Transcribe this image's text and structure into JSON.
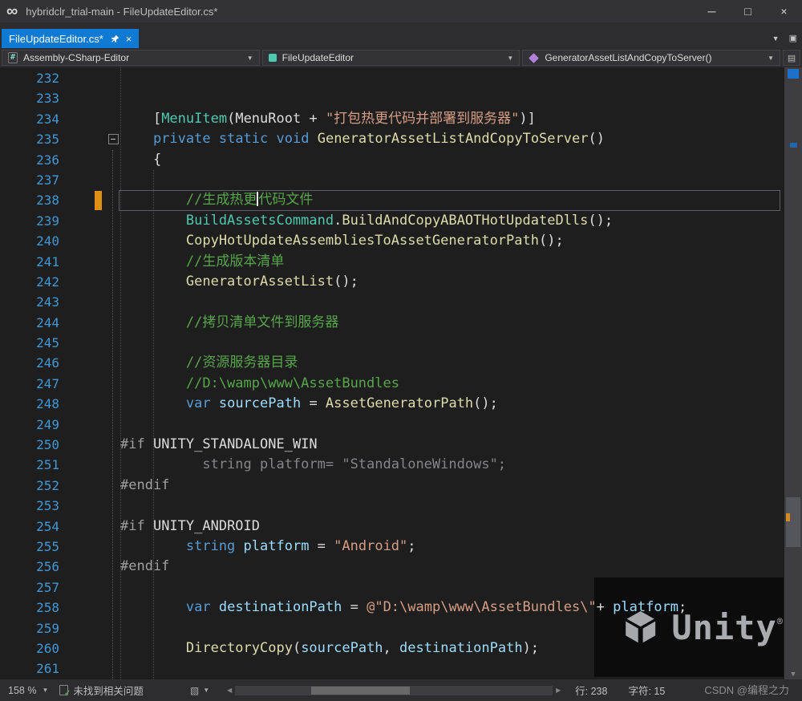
{
  "palette": {
    "plain": "#DCDCDC",
    "keyword": "#569CD6",
    "type": "#4EC9B0",
    "method": "#DCDCAA",
    "string": "#D69D85",
    "comment": "#57A64A",
    "local": "#9CDCFE",
    "preprocessor": "#A0A0A0",
    "inactive": "#85858A",
    "lineNumber": "#4098D4",
    "marker": "#DE9014",
    "currentLineBorder": "#5C5C64",
    "tabActive": "#0E7AD3",
    "editorBg": "#1E1E1E"
  },
  "icons": {
    "vsLogo": "∞",
    "minimize": "─",
    "maximize": "□",
    "close": "×",
    "tabClose": "×",
    "chevronDown": "▼",
    "windows": "▣",
    "navExtra": "▤",
    "cleanup": "▧",
    "scrollDown": "▼",
    "scrollLeft": "◀",
    "scrollRight": "▶",
    "foldCollapse": "−",
    "check": "✓"
  },
  "titlebar": {
    "title": "hybridclr_trial-main - FileUpdateEditor.cs*"
  },
  "tabbar": {
    "activeTab": "FileUpdateEditor.cs*"
  },
  "navbar": {
    "project": "Assembly-CSharp-Editor",
    "type": "FileUpdateEditor",
    "member": "GeneratorAssetListAndCopyToServer()"
  },
  "editor": {
    "lines": [
      {
        "n": 232,
        "ind": 0,
        "tokens": []
      },
      {
        "n": 233,
        "ind": 0,
        "tokens": []
      },
      {
        "n": 234,
        "ind": 4,
        "tokens": [
          {
            "t": "[",
            "c": "pl"
          },
          {
            "t": "MenuItem",
            "c": "ty"
          },
          {
            "t": "(",
            "c": "pl"
          },
          {
            "t": "MenuRoot",
            "c": "pl"
          },
          {
            "t": " + ",
            "c": "pl"
          },
          {
            "t": "\"打包热更代码并部署到服务器\"",
            "c": "st"
          },
          {
            "t": ")]",
            "c": "pl"
          }
        ]
      },
      {
        "n": 235,
        "ind": 4,
        "fold": true,
        "tokens": [
          {
            "t": "private",
            "c": "kw"
          },
          {
            "t": " ",
            "c": "pl"
          },
          {
            "t": "static",
            "c": "kw"
          },
          {
            "t": " ",
            "c": "pl"
          },
          {
            "t": "void",
            "c": "kw"
          },
          {
            "t": " ",
            "c": "pl"
          },
          {
            "t": "GeneratorAssetListAndCopyToServer",
            "c": "me"
          },
          {
            "t": "()",
            "c": "pl"
          }
        ]
      },
      {
        "n": 236,
        "ind": 4,
        "tokens": [
          {
            "t": "{",
            "c": "pl"
          }
        ]
      },
      {
        "n": 237,
        "ind": 0,
        "tokens": []
      },
      {
        "n": 238,
        "ind": 8,
        "cur": true,
        "mark": true,
        "tokens": [
          {
            "t": "//生成热更",
            "c": "co"
          },
          {
            "caret": true
          },
          {
            "t": "代码文件",
            "c": "co"
          }
        ]
      },
      {
        "n": 239,
        "ind": 8,
        "tokens": [
          {
            "t": "BuildAssetsCommand",
            "c": "ty"
          },
          {
            "t": ".",
            "c": "pl"
          },
          {
            "t": "BuildAndCopyABAOTHotUpdateDlls",
            "c": "me"
          },
          {
            "t": "();",
            "c": "pl"
          }
        ]
      },
      {
        "n": 240,
        "ind": 8,
        "tokens": [
          {
            "t": "CopyHotUpdateAssembliesToAssetGeneratorPath",
            "c": "me"
          },
          {
            "t": "();",
            "c": "pl"
          }
        ]
      },
      {
        "n": 241,
        "ind": 8,
        "tokens": [
          {
            "t": "//生成版本清单",
            "c": "co"
          }
        ]
      },
      {
        "n": 242,
        "ind": 8,
        "tokens": [
          {
            "t": "GeneratorAssetList",
            "c": "me"
          },
          {
            "t": "();",
            "c": "pl"
          }
        ]
      },
      {
        "n": 243,
        "ind": 0,
        "tokens": []
      },
      {
        "n": 244,
        "ind": 8,
        "tokens": [
          {
            "t": "//拷贝清单文件到服务器",
            "c": "co"
          }
        ]
      },
      {
        "n": 245,
        "ind": 0,
        "tokens": []
      },
      {
        "n": 246,
        "ind": 8,
        "tokens": [
          {
            "t": "//资源服务器目录",
            "c": "co"
          }
        ]
      },
      {
        "n": 247,
        "ind": 8,
        "tokens": [
          {
            "t": "//D:\\wamp\\www\\AssetBundles",
            "c": "co"
          }
        ]
      },
      {
        "n": 248,
        "ind": 8,
        "tokens": [
          {
            "t": "var",
            "c": "kw"
          },
          {
            "t": " ",
            "c": "pl"
          },
          {
            "t": "sourcePath",
            "c": "lo"
          },
          {
            "t": " = ",
            "c": "pl"
          },
          {
            "t": "AssetGeneratorPath",
            "c": "me"
          },
          {
            "t": "();",
            "c": "pl"
          }
        ]
      },
      {
        "n": 249,
        "ind": 0,
        "tokens": []
      },
      {
        "n": 250,
        "ind": 0,
        "tokens": [
          {
            "t": "#if",
            "c": "pp"
          },
          {
            "t": " UNITY_STANDALONE_WIN",
            "c": "pl"
          }
        ]
      },
      {
        "n": 251,
        "ind": 10,
        "tokens": [
          {
            "t": "string platform= \"StandaloneWindows\";",
            "c": "in"
          }
        ]
      },
      {
        "n": 252,
        "ind": 0,
        "tokens": [
          {
            "t": "#endif",
            "c": "pp"
          }
        ]
      },
      {
        "n": 253,
        "ind": 0,
        "tokens": []
      },
      {
        "n": 254,
        "ind": 0,
        "tokens": [
          {
            "t": "#if",
            "c": "pp"
          },
          {
            "t": " UNITY_ANDROID",
            "c": "pl"
          }
        ]
      },
      {
        "n": 255,
        "ind": 8,
        "tokens": [
          {
            "t": "string",
            "c": "kw"
          },
          {
            "t": " ",
            "c": "pl"
          },
          {
            "t": "platform",
            "c": "lo"
          },
          {
            "t": " = ",
            "c": "pl"
          },
          {
            "t": "\"Android\"",
            "c": "st"
          },
          {
            "t": ";",
            "c": "pl"
          }
        ]
      },
      {
        "n": 256,
        "ind": 0,
        "tokens": [
          {
            "t": "#endif",
            "c": "pp"
          }
        ]
      },
      {
        "n": 257,
        "ind": 0,
        "tokens": []
      },
      {
        "n": 258,
        "ind": 8,
        "tokens": [
          {
            "t": "var",
            "c": "kw"
          },
          {
            "t": " ",
            "c": "pl"
          },
          {
            "t": "destinationPath",
            "c": "lo"
          },
          {
            "t": " = ",
            "c": "pl"
          },
          {
            "t": "@\"D:\\wamp\\www\\AssetBundles\\\"",
            "c": "st"
          },
          {
            "t": "+ ",
            "c": "pl"
          },
          {
            "t": "platform",
            "c": "lo"
          },
          {
            "t": ";",
            "c": "pl"
          }
        ]
      },
      {
        "n": 259,
        "ind": 0,
        "tokens": []
      },
      {
        "n": 260,
        "ind": 8,
        "tokens": [
          {
            "t": "DirectoryCopy",
            "c": "me"
          },
          {
            "t": "(",
            "c": "pl"
          },
          {
            "t": "sourcePath",
            "c": "lo"
          },
          {
            "t": ", ",
            "c": "pl"
          },
          {
            "t": "destinationPath",
            "c": "lo"
          },
          {
            "t": ");",
            "c": "pl"
          }
        ]
      },
      {
        "n": 261,
        "ind": 0,
        "tokens": []
      }
    ]
  },
  "bottombar": {
    "zoom": "158 %",
    "problems": "未找到相关问题",
    "line": "行: 238",
    "column": "字符: 15",
    "csdnWatermark": "CSDN @编程之力"
  },
  "unityWatermark": {
    "brand": "Unity",
    "registered": "®"
  }
}
